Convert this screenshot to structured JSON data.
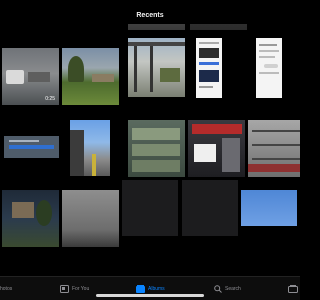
{
  "header": {
    "title": "Recents"
  },
  "grid": {
    "photos": [
      {
        "name": "photo-top-strip-1",
        "duration": ""
      },
      {
        "name": "photo-top-strip-2",
        "duration": ""
      },
      {
        "name": "photo-video-patio",
        "duration": "0:25"
      },
      {
        "name": "photo-backyard",
        "duration": ""
      },
      {
        "name": "photo-porch",
        "duration": ""
      },
      {
        "name": "photo-screenshot-app",
        "duration": ""
      },
      {
        "name": "photo-screenshot-messages",
        "duration": ""
      },
      {
        "name": "photo-blue-card",
        "duration": ""
      },
      {
        "name": "photo-walkway",
        "duration": ""
      },
      {
        "name": "photo-store-pallets",
        "duration": ""
      },
      {
        "name": "photo-price-sign",
        "duration": ""
      },
      {
        "name": "photo-store-racks",
        "duration": ""
      },
      {
        "name": "photo-night-house",
        "duration": ""
      },
      {
        "name": "photo-gray-sky",
        "duration": ""
      },
      {
        "name": "photo-dark-1",
        "duration": ""
      },
      {
        "name": "photo-dark-2",
        "duration": ""
      },
      {
        "name": "photo-blue-sky",
        "duration": ""
      }
    ]
  },
  "tabbar": {
    "photos_label": "hotos",
    "for_you_label": "For You",
    "albums_label": "Albums",
    "search_label": "Search"
  },
  "colors": {
    "accent": "#0a84ff",
    "inactive": "#8e8e93",
    "background": "#000000"
  }
}
